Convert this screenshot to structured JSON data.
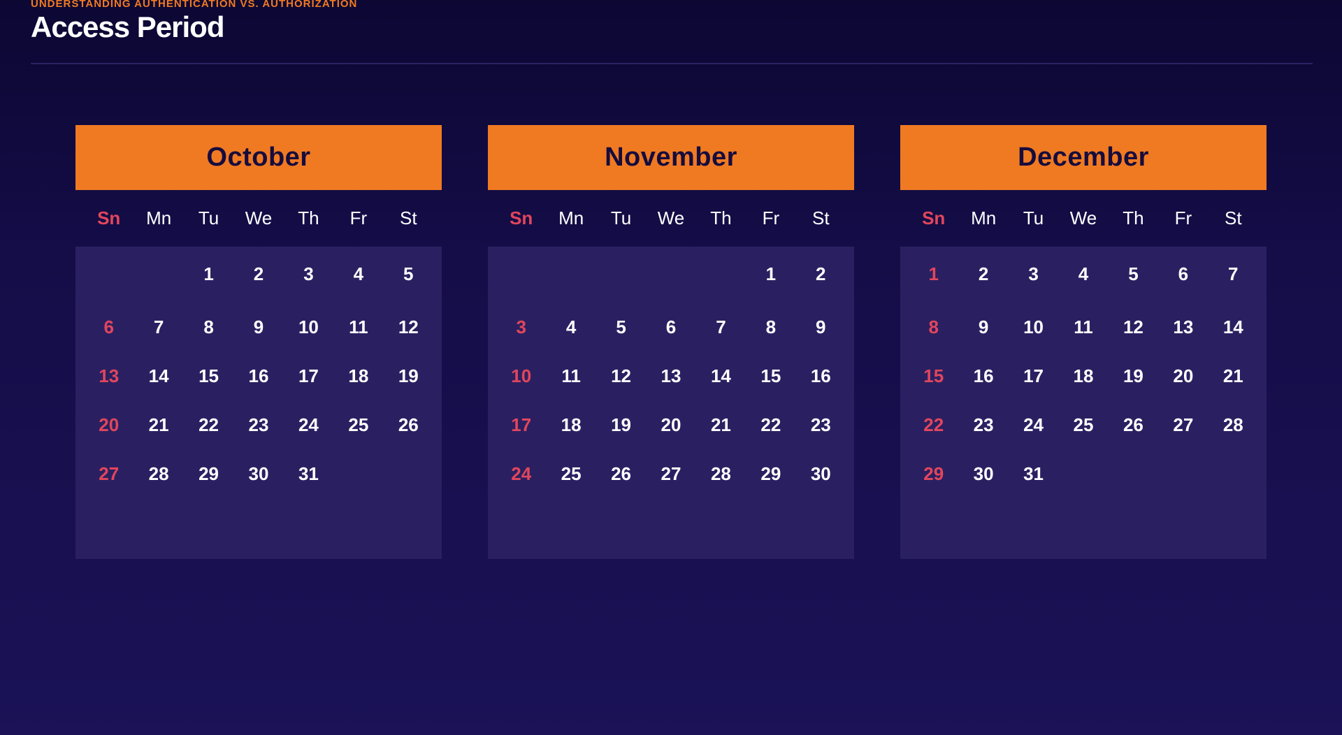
{
  "header": {
    "kicker": "UNDERSTANDING AUTHENTICATION VS. AUTHORIZATION",
    "title": "Access Period"
  },
  "colors": {
    "accent": "#f07a22",
    "sunday": "#e1465d",
    "background": "#150d48",
    "panel": "#2a2061"
  },
  "calendar": {
    "weekdays": [
      "Sn",
      "Mn",
      "Tu",
      "We",
      "Th",
      "Fr",
      "St"
    ],
    "months": [
      {
        "name": "October",
        "weeks": [
          [
            "",
            "",
            "1",
            "2",
            "3",
            "4",
            "5"
          ],
          [
            "6",
            "7",
            "8",
            "9",
            "10",
            "11",
            "12"
          ],
          [
            "13",
            "14",
            "15",
            "16",
            "17",
            "18",
            "19"
          ],
          [
            "20",
            "21",
            "22",
            "23",
            "24",
            "25",
            "26"
          ],
          [
            "27",
            "28",
            "29",
            "30",
            "31",
            "",
            ""
          ]
        ]
      },
      {
        "name": "November",
        "weeks": [
          [
            "",
            "",
            "",
            "",
            "",
            "1",
            "2"
          ],
          [
            "3",
            "4",
            "5",
            "6",
            "7",
            "8",
            "9"
          ],
          [
            "10",
            "11",
            "12",
            "13",
            "14",
            "15",
            "16"
          ],
          [
            "17",
            "18",
            "19",
            "20",
            "21",
            "22",
            "23"
          ],
          [
            "24",
            "25",
            "26",
            "27",
            "28",
            "29",
            "30"
          ]
        ]
      },
      {
        "name": "December",
        "weeks": [
          [
            "1",
            "2",
            "3",
            "4",
            "5",
            "6",
            "7"
          ],
          [
            "8",
            "9",
            "10",
            "11",
            "12",
            "13",
            "14"
          ],
          [
            "15",
            "16",
            "17",
            "18",
            "19",
            "20",
            "21"
          ],
          [
            "22",
            "23",
            "24",
            "25",
            "26",
            "27",
            "28"
          ],
          [
            "29",
            "30",
            "31",
            "",
            "",
            "",
            ""
          ]
        ]
      }
    ]
  }
}
